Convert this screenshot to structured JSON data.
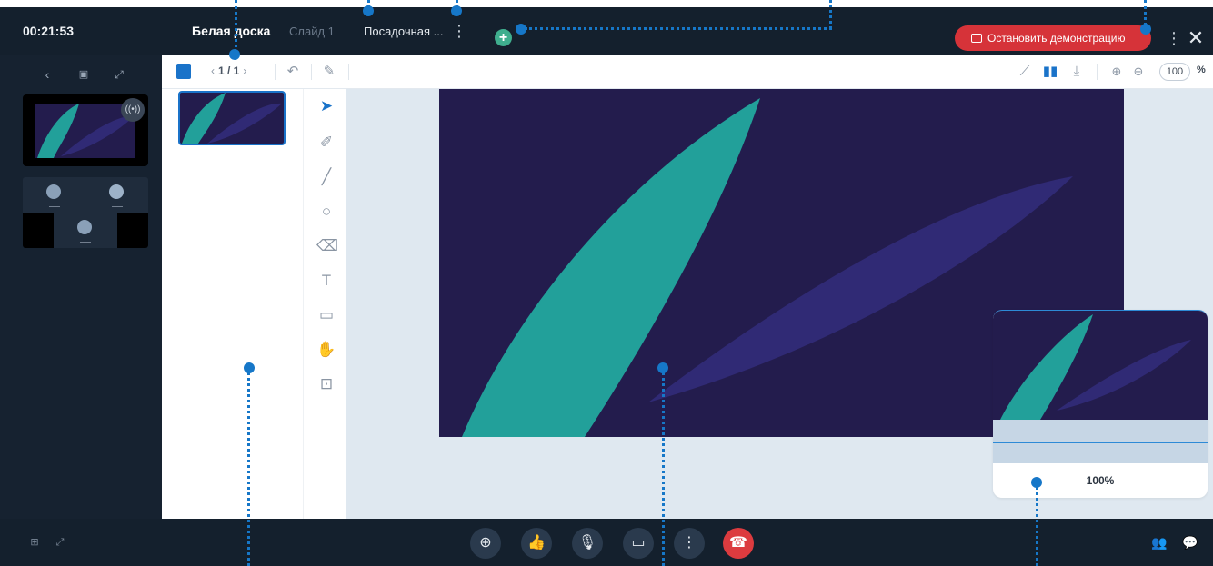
{
  "topbar": {
    "timer": "00:21:53",
    "tab_whiteboard": "Белая доска",
    "tab_slide": "Слайд 1",
    "tab_landing": "Посадочная ...",
    "tab_menu_icon": "more-vertical-icon",
    "add_tab_icon": "plus-icon",
    "stop_demo_label": "Остановить демонстрацию",
    "more_icon": "more-vertical-icon",
    "close_icon": "close-icon"
  },
  "left_panel": {
    "tools": [
      "chevron-left-icon",
      "pip-icon",
      "expand-icon"
    ],
    "speaker_icon": "speaking-indicator-icon",
    "participants": [
      "participant-1",
      "participant-2",
      "participant-3"
    ]
  },
  "board": {
    "toolbar": {
      "pager": "1 / 1",
      "undo_icon": "undo-icon",
      "clear_icon": "brush-icon",
      "right_icons": [
        "pointer-off-icon",
        "library-icon",
        "download-icon",
        "zoom-in-icon",
        "zoom-out-icon"
      ],
      "zoom_value": "100",
      "zoom_unit": "%"
    },
    "tools": [
      "select-icon",
      "pencil-icon",
      "line-icon",
      "shape-icon",
      "eraser-icon",
      "text-icon",
      "comment-icon",
      "hand-icon",
      "image-insert-icon"
    ],
    "minimap_zoom": "100%"
  },
  "bottombar": {
    "left_icons": [
      "grid-layout-icon",
      "fullscreen-icon"
    ],
    "buttons": [
      "globe-icon",
      "thumbs-up-icon",
      "microphone-icon",
      "camera-icon",
      "more-vertical-icon",
      "hang-up-icon"
    ],
    "right_icons": [
      "participants-icon",
      "chat-icon"
    ]
  },
  "colors": {
    "accent": "#1677c8",
    "end_call": "#dc3b3f",
    "add_tab": "#3fae8e",
    "canvas_bg": "#231c4d",
    "leaf_teal": "#22a09a",
    "leaf_purple": "#302a75"
  }
}
